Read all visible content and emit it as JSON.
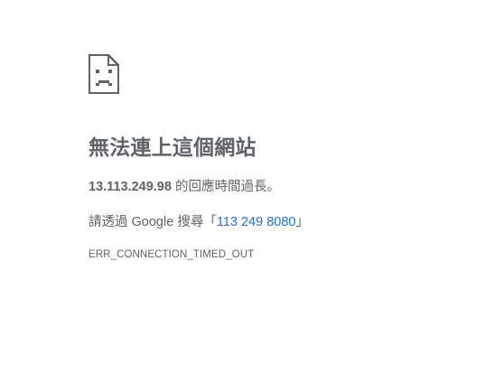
{
  "icon": {
    "name": "sad-page-icon"
  },
  "error": {
    "headline": "無法連上這個網站",
    "host": "13.113.249.98",
    "summary_suffix": " 的回應時間過長。",
    "suggestion_prefix": "請透過 Google 搜尋「",
    "suggestion_link": "113 249 8080",
    "suggestion_suffix": "」",
    "code": "ERR_CONNECTION_TIMED_OUT"
  },
  "colors": {
    "text": "#5f6368",
    "link": "#1a73e8",
    "background": "#ffffff"
  }
}
